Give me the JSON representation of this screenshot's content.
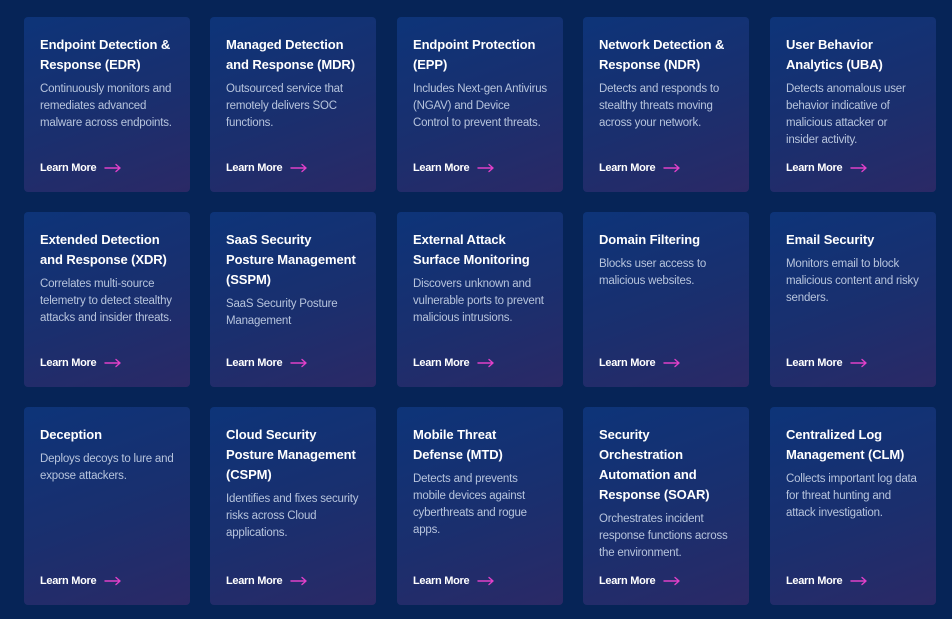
{
  "colors": {
    "background": "#062457",
    "accent": "#e040c8",
    "card": "#0d3479"
  },
  "cards": [
    {
      "title": "Endpoint Detection & Response (EDR)",
      "desc": "Continuously monitors and remediates advanced malware across endpoints.",
      "link": "Learn More"
    },
    {
      "title": "Managed Detection and Response (MDR)",
      "desc": "Outsourced service that remotely delivers SOC functions.",
      "link": "Learn More"
    },
    {
      "title": "Endpoint Protection (EPP)",
      "desc": "Includes Next-gen Antivirus (NGAV) and Device Control to prevent threats.",
      "link": "Learn More"
    },
    {
      "title": "Network Detection & Response (NDR)",
      "desc": "Detects and responds to stealthy threats moving across your network.",
      "link": "Learn More"
    },
    {
      "title": "User Behavior Analytics (UBA)",
      "desc": "Detects anomalous user behavior indicative of malicious attacker or insider activity.",
      "link": "Learn More"
    },
    {
      "title": "Extended Detection and Response (XDR)",
      "desc": "Correlates multi-source telemetry to detect stealthy attacks and insider threats.",
      "link": "Learn More"
    },
    {
      "title": "SaaS Security Posture Management (SSPM)",
      "desc": "SaaS Security Posture Management",
      "link": "Learn More"
    },
    {
      "title": "External Attack Surface Monitoring",
      "desc": "Discovers unknown and vulnerable ports to prevent malicious intrusions.",
      "link": "Learn More"
    },
    {
      "title": "Domain Filtering",
      "desc": "Blocks user access to malicious websites.",
      "link": "Learn More"
    },
    {
      "title": "Email Security",
      "desc": "Monitors email to block malicious content and risky senders.",
      "link": "Learn More"
    },
    {
      "title": "Deception",
      "desc": "Deploys decoys to lure and expose attackers.",
      "link": "Learn More"
    },
    {
      "title": "Cloud Security Posture Management (CSPM)",
      "desc": "Identifies and fixes security risks across Cloud applications.",
      "link": "Learn More"
    },
    {
      "title": "Mobile Threat Defense (MTD)",
      "desc": "Detects and prevents mobile devices against cyberthreats and rogue apps.",
      "link": "Learn More"
    },
    {
      "title": "Security Orchestration Automation and Response (SOAR)",
      "desc": "Orchestrates incident response functions across the environment.",
      "link": "Learn More"
    },
    {
      "title": "Centralized Log Management (CLM)",
      "desc": "Collects important log data for threat hunting and attack investigation.",
      "link": "Learn More"
    }
  ]
}
